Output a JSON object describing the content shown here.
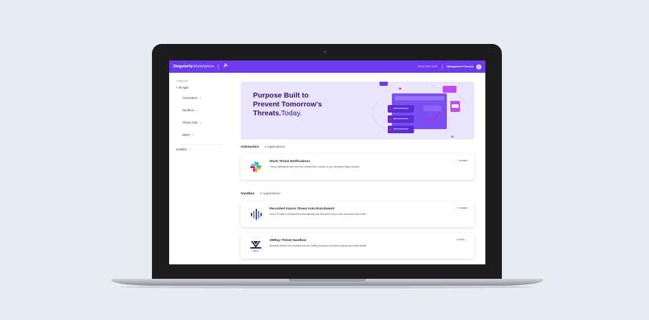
{
  "topbar": {
    "brand_bold": "Singularity",
    "brand_light": "Marketplace",
    "logo_icon": "singularity-swirl-icon",
    "account": "SENTINELONE",
    "console_link": "Management Console",
    "user_icon": "user-circle-icon"
  },
  "sidebar": {
    "heading": "Categories",
    "all_apps": "< All Apps",
    "categories": [
      {
        "label": "Automation",
        "count": "1"
      },
      {
        "label": "Sandbox",
        "count": "2"
      },
      {
        "label": "Threat Intel",
        "count": "4"
      },
      {
        "label": "SIEM",
        "count": "1"
      }
    ],
    "installed": {
      "label": "Installed",
      "count": "2"
    }
  },
  "hero": {
    "line1": "Purpose Built to",
    "line2": "Prevent Tomorrow's",
    "line3_bold": "Threats.",
    "line3_light": "Today."
  },
  "sections": [
    {
      "title": "Automation",
      "count_label": "1 Applications",
      "apps": [
        {
          "name": "Slack Threat Notifications",
          "description": "Threat notifications sent from the SentinelOne console to your dedicated Slack channel",
          "status": "Installed",
          "icon": "slack-icon"
        }
      ]
    },
    {
      "title": "Sandbox",
      "count_label": "2 Applications",
      "apps": [
        {
          "name": "Recorded Future Threat Auto-Enrichment",
          "description": "Enrich Threats in SentinelOne automatically with Recorded Future Risk Score and Risk Rules",
          "status": "Installed",
          "icon": "recorded-future-icon"
        },
        {
          "name": "VMRay Threat Sandbox",
          "description": "Detonate threats from SentinelOne into VMRay Sandbox for further analysis and threat details",
          "action": "Details →",
          "icon": "vmray-icon",
          "icon_caption": "VMRAY"
        }
      ]
    }
  ],
  "colors": {
    "accent": "#6c3bf0",
    "hero_bg": "#ebe5fb",
    "installed_check": "#20b09a",
    "page_bg": "#e9ebf2"
  }
}
